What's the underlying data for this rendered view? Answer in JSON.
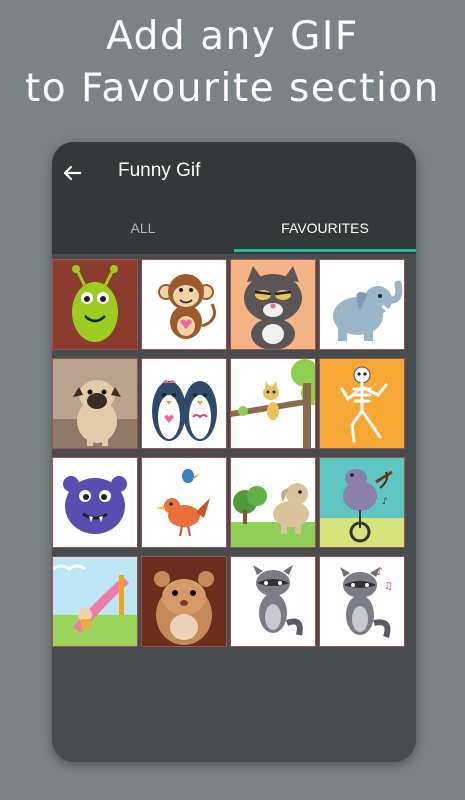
{
  "promo": {
    "line1": "Add any GIF",
    "line2": "to Favourite section"
  },
  "appbar": {
    "title": "Funny Gif",
    "back_icon": "arrow-left-icon"
  },
  "tabs": [
    {
      "label": "ALL",
      "selected": false
    },
    {
      "label": "FAVOURITES",
      "selected": true
    }
  ],
  "colors": {
    "background": "#7c8385",
    "appbar": "#343838",
    "content": "#474c4e",
    "indicator": "#2bb39a",
    "tile_border": "#a05050"
  },
  "gifs": [
    {
      "name": "green-monster"
    },
    {
      "name": "monkey"
    },
    {
      "name": "grumpy-cat"
    },
    {
      "name": "elephant"
    },
    {
      "name": "pug"
    },
    {
      "name": "penguins"
    },
    {
      "name": "cat-on-branch"
    },
    {
      "name": "dancing-skeleton"
    },
    {
      "name": "purple-monster"
    },
    {
      "name": "birds"
    },
    {
      "name": "elephant-in-park"
    },
    {
      "name": "hippo-unicycle"
    },
    {
      "name": "slide"
    },
    {
      "name": "hamster"
    },
    {
      "name": "raccoon"
    },
    {
      "name": "raccoon-music"
    }
  ]
}
